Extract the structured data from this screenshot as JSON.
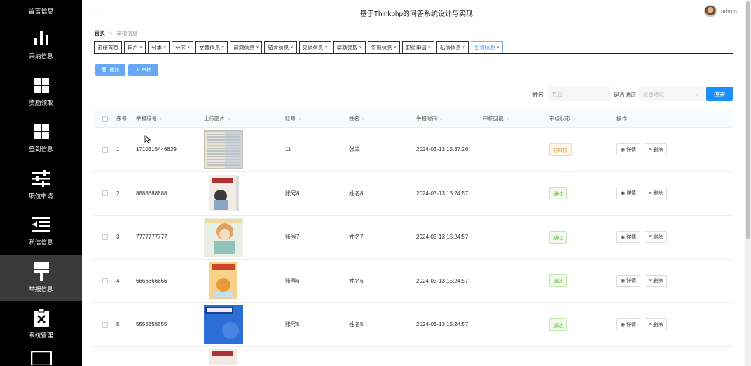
{
  "sidebar": {
    "title": "留言信息",
    "items": [
      {
        "label": "采纳信息",
        "icon": "bar-chart-icon"
      },
      {
        "label": "奖励领取",
        "icon": "grid-icon"
      },
      {
        "label": "签到信息",
        "icon": "grid-icon"
      },
      {
        "label": "职位申请",
        "icon": "sliders-icon"
      },
      {
        "label": "私信信息",
        "icon": "indent-list-icon"
      },
      {
        "label": "举报信息",
        "icon": "brush-icon",
        "active": true
      },
      {
        "label": "系统管理",
        "icon": "clipboard-x-icon"
      }
    ]
  },
  "header": {
    "menu": "···",
    "title": "基于Thinkphp的问答系统设计与实现",
    "user": "admin"
  },
  "breadcrumb": {
    "home": "首页",
    "current": "举报信息"
  },
  "tabs": [
    {
      "label": "系统首页",
      "closable": false
    },
    {
      "label": "用户",
      "closable": true
    },
    {
      "label": "分类",
      "closable": true
    },
    {
      "label": "分区",
      "closable": true
    },
    {
      "label": "文章信息",
      "closable": true
    },
    {
      "label": "问题信息",
      "closable": true
    },
    {
      "label": "留言信息",
      "closable": true
    },
    {
      "label": "采纳信息",
      "closable": true
    },
    {
      "label": "奖励领取",
      "closable": true
    },
    {
      "label": "签到信息",
      "closable": true
    },
    {
      "label": "职位申请",
      "closable": true
    },
    {
      "label": "私信信息",
      "closable": true
    },
    {
      "label": "举报信息",
      "closable": true,
      "active": true
    }
  ],
  "actions": {
    "delete": "删除",
    "audit": "审核"
  },
  "search": {
    "name_label": "姓名",
    "name_placeholder": "姓名",
    "pass_label": "是否通过",
    "pass_placeholder": "是否通过",
    "button": "搜索"
  },
  "table": {
    "headers": [
      "序号",
      "举报编号",
      "上传图片",
      "账号",
      "姓名",
      "举报时间",
      "审核回复",
      "审核状态",
      "操作"
    ],
    "detail_label": "详情",
    "delete_label": "删除",
    "rows": [
      {
        "index": "1",
        "code": "1710315446829",
        "image": "note-photo",
        "account": "11",
        "name": "张三",
        "time": "2024-03-13 15:37:26",
        "reply": "",
        "status": "待审核",
        "status_type": "pending"
      },
      {
        "index": "2",
        "code": "8888888888",
        "image": "book-cover-girl",
        "account": "账号8",
        "name": "姓名8",
        "time": "2024-03-13 15:24:57",
        "reply": "",
        "status": "通过",
        "status_type": "pass"
      },
      {
        "index": "3",
        "code": "7777777777",
        "image": "illustration-girl",
        "account": "账号7",
        "name": "姓名7",
        "time": "2024-03-13 15:24:57",
        "reply": "",
        "status": "通过",
        "status_type": "pass"
      },
      {
        "index": "4",
        "code": "6666666666",
        "image": "magazine-cover",
        "account": "账号6",
        "name": "姓名6",
        "time": "2024-03-13 15:24:57",
        "reply": "",
        "status": "通过",
        "status_type": "pass"
      },
      {
        "index": "5",
        "code": "5555555555",
        "image": "blue-cover",
        "account": "账号5",
        "name": "姓名5",
        "time": "2024-03-13 15:24:57",
        "reply": "",
        "status": "通过",
        "status_type": "pass"
      }
    ]
  },
  "colors": {
    "primary": "#1890ff",
    "sidebar_bg": "#000000",
    "active_tab": "#409eff"
  }
}
